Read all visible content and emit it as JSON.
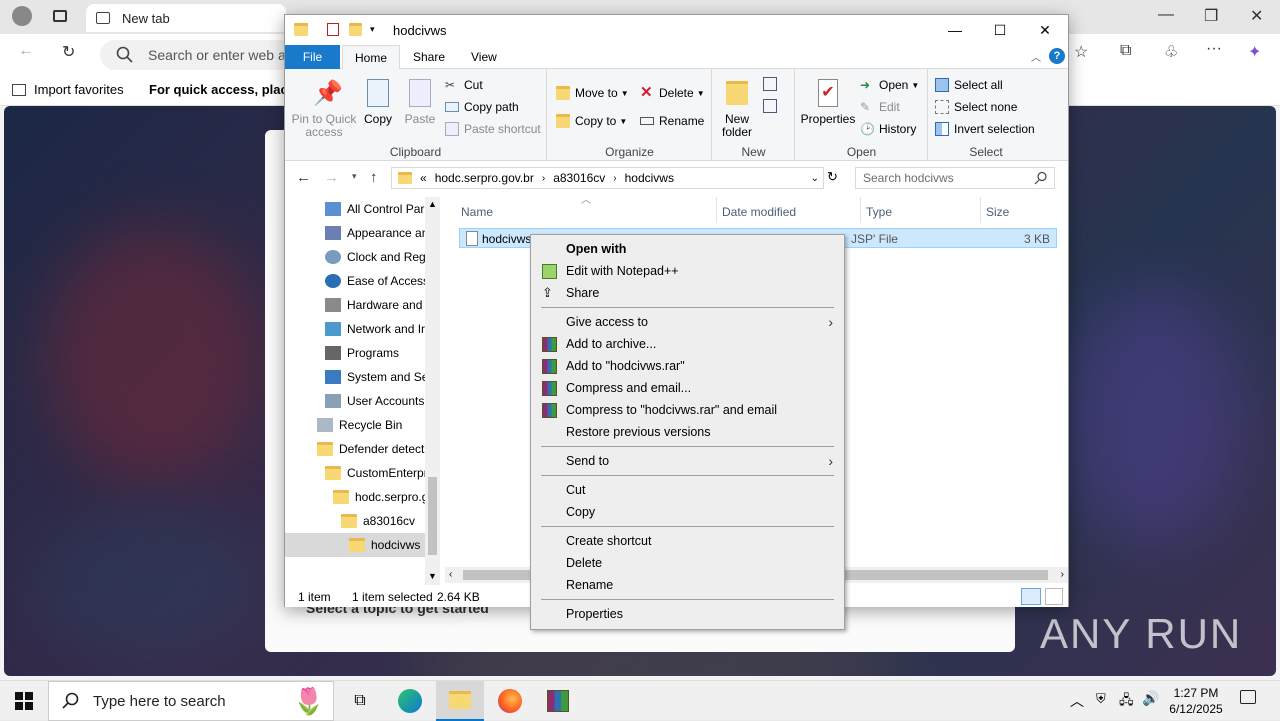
{
  "edge": {
    "tab_title": "New tab",
    "address_placeholder": "Search or enter web a",
    "favbar": {
      "import": "Import favorites",
      "quick_access": "For quick access, place y"
    },
    "content": {
      "topic": "Select a topic to get started",
      "watermark": "ANY RUN"
    }
  },
  "explorer": {
    "title": "hodcivws",
    "tabs": {
      "file": "File",
      "home": "Home",
      "share": "Share",
      "view": "View"
    },
    "ribbon": {
      "clipboard": {
        "label": "Clipboard",
        "pin": "Pin to Quick access",
        "copy": "Copy",
        "paste": "Paste",
        "cut": "Cut",
        "copy_path": "Copy path",
        "paste_shortcut": "Paste shortcut"
      },
      "organize": {
        "label": "Organize",
        "move_to": "Move to",
        "copy_to": "Copy to",
        "delete": "Delete",
        "rename": "Rename"
      },
      "new": {
        "label": "New",
        "new_folder": "New folder"
      },
      "open": {
        "label": "Open",
        "properties": "Properties",
        "open": "Open",
        "edit": "Edit",
        "history": "History"
      },
      "select": {
        "label": "Select",
        "select_all": "Select all",
        "select_none": "Select none",
        "invert": "Invert selection"
      }
    },
    "path": {
      "prefix": "«",
      "parts": [
        "hodc.serpro.gov.br",
        "a83016cv",
        "hodcivws"
      ]
    },
    "search_placeholder": "Search hodcivws",
    "nav_items": [
      "All Control Par",
      "Appearance an",
      "Clock and Regi",
      "Ease of Access",
      "Hardware and",
      "Network and Ir",
      "Programs",
      "System and Se",
      "User Accounts",
      "Recycle Bin",
      "Defender detect",
      "CustomEnterpr",
      "hodc.serpro.g",
      "a83016cv",
      "hodcivws"
    ],
    "columns": {
      "name": "Name",
      "date": "Date modified",
      "type": "Type",
      "size": "Size"
    },
    "file": {
      "name": "hodcivws",
      "type": "JSP' File",
      "size": "3 KB"
    },
    "status": {
      "count": "1 item",
      "selected": "1 item selected",
      "size": "2.64 KB"
    }
  },
  "context_menu": {
    "open_with": "Open with",
    "edit_notepad": "Edit with Notepad++",
    "share": "Share",
    "give_access": "Give access to",
    "add_archive": "Add to archive...",
    "add_rar": "Add to \"hodcivws.rar\"",
    "compress_email": "Compress and email...",
    "compress_rar_email": "Compress to \"hodcivws.rar\" and email",
    "restore": "Restore previous versions",
    "send_to": "Send to",
    "cut": "Cut",
    "copy": "Copy",
    "create_shortcut": "Create shortcut",
    "delete": "Delete",
    "rename": "Rename",
    "properties": "Properties"
  },
  "taskbar": {
    "search_placeholder": "Type here to search",
    "time": "1:27 PM",
    "date": "6/12/2025"
  }
}
